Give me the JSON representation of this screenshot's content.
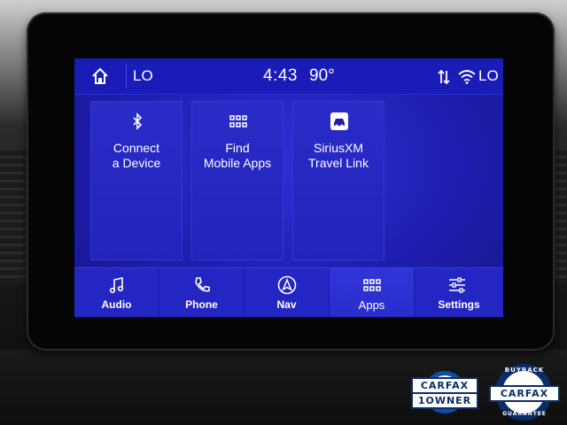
{
  "status_bar": {
    "left_temp": "LO",
    "time": "4:43",
    "outside_temp": "90°",
    "right_temp": "LO"
  },
  "tiles": [
    {
      "label": "Connect\na Device",
      "icon": "bluetooth-icon"
    },
    {
      "label": "Find\nMobile Apps",
      "icon": "apps-grid-icon"
    },
    {
      "label": "SiriusXM\nTravel Link",
      "icon": "car-info-icon"
    }
  ],
  "bottom_nav": [
    {
      "label": "Audio",
      "icon": "music-note-icon",
      "active": false
    },
    {
      "label": "Phone",
      "icon": "phone-icon",
      "active": false
    },
    {
      "label": "Nav",
      "icon": "navigation-icon",
      "active": false
    },
    {
      "label": "Apps",
      "icon": "apps-grid-icon",
      "active": true
    },
    {
      "label": "Settings",
      "icon": "settings-sliders-icon",
      "active": false
    }
  ],
  "badges": {
    "carfax_one_owner_top": "CARFAX",
    "carfax_one_owner_bottom": "1OWNER",
    "carfax_buyback_top": "BUYBACK",
    "carfax_buyback_mid": "CARFAX",
    "carfax_buyback_bottom": "GUARANTEE"
  },
  "colors": {
    "screen_blue": "#1e1fb0",
    "tile_blue": "#2a2cc8",
    "carfax_navy": "#0b2c66"
  }
}
